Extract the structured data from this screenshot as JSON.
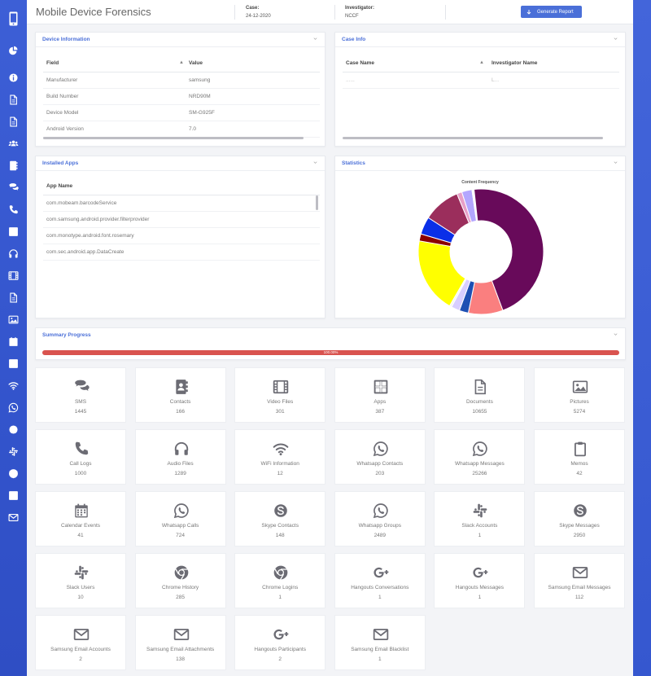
{
  "header": {
    "title": "Mobile Device Forensics",
    "case_label": "Case: ",
    "case_value": "24-12-2020",
    "investigator_label": "Investigator: ",
    "investigator_value": "NCCF",
    "generate_label": "Generate Report"
  },
  "device_info": {
    "title": "Device Information",
    "columns": [
      "Field",
      "Value"
    ],
    "rows": [
      {
        "field": "Manufacturer",
        "value": "samsung"
      },
      {
        "field": "Build Number",
        "value": "NRD90M"
      },
      {
        "field": "Device Model",
        "value": "SM-G925F"
      },
      {
        "field": "Android Version",
        "value": "7.0"
      }
    ]
  },
  "case_info": {
    "title": "Case Info",
    "columns": [
      "Case Name",
      "Investigator Name"
    ],
    "rows": [
      {
        "case_name": "......",
        "investigator": "L..."
      }
    ]
  },
  "installed_apps": {
    "title": "Installed Apps",
    "column": "App Name",
    "rows": [
      "com.mobeam.barcodeService",
      "com.samsung.android.provider.filterprovider",
      "com.monotype.android.font.rosemary",
      "com.sec.android.app.DataCreate"
    ]
  },
  "statistics": {
    "title": "Statistics"
  },
  "chart_data": {
    "type": "pie",
    "title": "Content Frequency",
    "donut": true,
    "series": [
      {
        "value": 10655,
        "color": "#ffff00"
      },
      {
        "value": 1000,
        "color": "#8b0000"
      },
      {
        "value": 2489,
        "color": "#0a2fe8"
      },
      {
        "value": 5274,
        "color": "#9b2e5c"
      },
      {
        "value": 724,
        "color": "#e8a0c8"
      },
      {
        "value": 1445,
        "color": "#b3a6ff"
      },
      {
        "value": 301,
        "color": "#ffffff"
      },
      {
        "value": 25266,
        "color": "#680a5a"
      },
      {
        "value": 4900,
        "color": "#fa7f7f"
      },
      {
        "value": 1289,
        "color": "#1e4fb3"
      },
      {
        "value": 1200,
        "color": "#d8ceff"
      },
      {
        "value": 300,
        "color": "#f5f5f5"
      }
    ]
  },
  "summary": {
    "title": "Summary Progress",
    "progress_pct": 100,
    "progress_label": "100.00%"
  },
  "stats": [
    {
      "label": "SMS",
      "count": "1445",
      "icon": "comments-icon"
    },
    {
      "label": "Contacts",
      "count": "166",
      "icon": "address-book-icon"
    },
    {
      "label": "Video Files",
      "count": "301",
      "icon": "film-icon"
    },
    {
      "label": "Apps",
      "count": "387",
      "icon": "grid-icon"
    },
    {
      "label": "Documents",
      "count": "10655",
      "icon": "document-icon"
    },
    {
      "label": "Pictures",
      "count": "5274",
      "icon": "image-icon"
    },
    {
      "label": "Call Logs",
      "count": "1000",
      "icon": "phone-icon"
    },
    {
      "label": "Audio Files",
      "count": "1289",
      "icon": "headphones-icon"
    },
    {
      "label": "WiFi Information",
      "count": "12",
      "icon": "wifi-icon"
    },
    {
      "label": "Whatsapp Contacts",
      "count": "203",
      "icon": "whatsapp-icon"
    },
    {
      "label": "Whatsapp Messages",
      "count": "25266",
      "icon": "whatsapp-icon"
    },
    {
      "label": "Memos",
      "count": "42",
      "icon": "clipboard-icon"
    },
    {
      "label": "Calendar Events",
      "count": "41",
      "icon": "calendar-icon"
    },
    {
      "label": "Whatsapp Calls",
      "count": "724",
      "icon": "whatsapp-icon"
    },
    {
      "label": "Skype Contacts",
      "count": "148",
      "icon": "skype-icon"
    },
    {
      "label": "Whatsapp Groups",
      "count": "2489",
      "icon": "whatsapp-icon"
    },
    {
      "label": "Slack Accounts",
      "count": "1",
      "icon": "slack-icon"
    },
    {
      "label": "Skype Messages",
      "count": "2950",
      "icon": "skype-icon"
    },
    {
      "label": "Slack Users",
      "count": "10",
      "icon": "slack-icon"
    },
    {
      "label": "Chrome History",
      "count": "285",
      "icon": "chrome-icon"
    },
    {
      "label": "Chrome Logins",
      "count": "1",
      "icon": "chrome-icon"
    },
    {
      "label": "Hangouts Conversations",
      "count": "1",
      "icon": "google-plus-icon"
    },
    {
      "label": "Hangouts Messages",
      "count": "1",
      "icon": "google-plus-icon"
    },
    {
      "label": "Samsung Email Messages",
      "count": "112",
      "icon": "envelope-icon"
    },
    {
      "label": "Samsung Email Accounts",
      "count": "2",
      "icon": "envelope-icon"
    },
    {
      "label": "Samsung Email Attachments",
      "count": "138",
      "icon": "envelope-icon"
    },
    {
      "label": "Hangouts Participants",
      "count": "2",
      "icon": "google-plus-icon"
    },
    {
      "label": "Samsung Email Blacklist",
      "count": "1",
      "icon": "envelope-icon"
    }
  ],
  "sidebar": {
    "items": [
      "pie-chart-icon",
      "info-icon",
      "document-icon",
      "document-icon",
      "users-icon",
      "address-book-icon",
      "comments-icon",
      "phone-icon",
      "grid-icon",
      "headphones-icon",
      "film-icon",
      "document-icon",
      "image-icon",
      "calendar-icon",
      "grid-icon",
      "wifi-icon",
      "whatsapp-icon",
      "skype-icon",
      "slack-icon",
      "chrome-icon",
      "grid-icon",
      "envelope-icon"
    ]
  }
}
